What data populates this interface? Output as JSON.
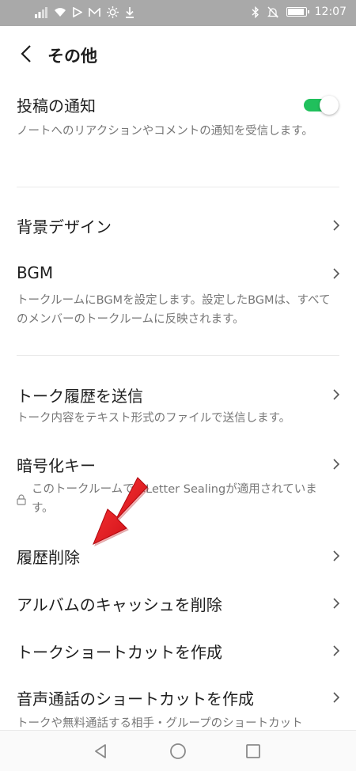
{
  "status_bar": {
    "time": "12:07",
    "left_icons": [
      "signal-icon",
      "wifi-icon",
      "play-icon",
      "mail-icon",
      "brightness-icon",
      "download-icon"
    ],
    "right_icons": [
      "bluetooth-icon",
      "mute-icon",
      "battery-icon"
    ]
  },
  "header": {
    "title": "その他"
  },
  "items": {
    "post_notification": {
      "title": "投稿の通知",
      "description": "ノートへのリアクションやコメントの通知を受信します。",
      "toggle_on": true
    },
    "background_design": {
      "title": "背景デザイン"
    },
    "bgm": {
      "title": "BGM",
      "description": "トークルームにBGMを設定します。設定したBGMは、すべてのメンバーのトークルームに反映されます。"
    },
    "send_history": {
      "title": "トーク履歴を送信",
      "description": "トーク内容をテキスト形式のファイルで送信します。"
    },
    "encryption_key": {
      "title": "暗号化キー",
      "description": "このトークルームではLetter Sealingが適用されています。"
    },
    "delete_history": {
      "title": "履歴削除"
    },
    "delete_album_cache": {
      "title": "アルバムのキャッシュを削除"
    },
    "create_shortcut": {
      "title": "トークショートカットを作成"
    },
    "voice_call_shortcut": {
      "title": "音声通話のショートカットを作成",
      "description": "トークや無料通話する相手・グループのショートカット"
    }
  },
  "colors": {
    "toggle_on": "#20c05c",
    "annotation_arrow": "#e8141c"
  }
}
